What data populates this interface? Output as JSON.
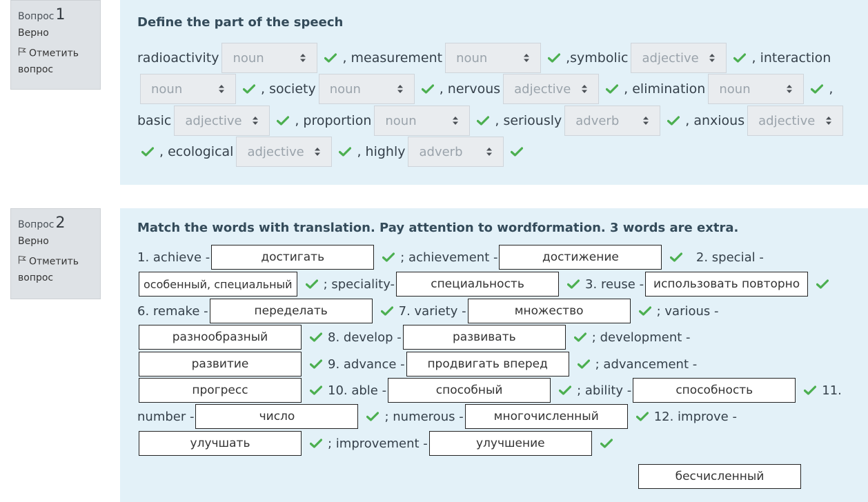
{
  "q1": {
    "label": "Вопрос",
    "number": "1",
    "state": "Верно",
    "flag": "Отметить вопрос",
    "question": "Define the part of the speech",
    "rows": [
      [
        {
          "t": "text",
          "v": "radioactivity"
        },
        {
          "t": "sel",
          "v": "noun"
        },
        {
          "t": "check"
        },
        {
          "t": "text",
          "v": ", measurement"
        },
        {
          "t": "sel",
          "v": "noun"
        },
        {
          "t": "check"
        },
        {
          "t": "text",
          "v": ",symbolic"
        },
        {
          "t": "sel",
          "v": "adjective"
        },
        {
          "t": "check"
        },
        {
          "t": "text",
          "v": ", interaction"
        }
      ],
      [
        {
          "t": "sel",
          "v": "noun"
        },
        {
          "t": "check"
        },
        {
          "t": "text",
          "v": ", society"
        },
        {
          "t": "sel",
          "v": "noun"
        },
        {
          "t": "check"
        },
        {
          "t": "text",
          "v": ", nervous"
        },
        {
          "t": "sel",
          "v": "adjective"
        },
        {
          "t": "check"
        },
        {
          "t": "text",
          "v": ", elimination"
        },
        {
          "t": "sel",
          "v": "noun"
        },
        {
          "t": "check"
        },
        {
          "t": "text",
          "v": ","
        }
      ],
      [
        {
          "t": "text",
          "v": "basic"
        },
        {
          "t": "sel",
          "v": "adjective"
        },
        {
          "t": "check"
        },
        {
          "t": "text",
          "v": ", proportion"
        },
        {
          "t": "sel",
          "v": "noun"
        },
        {
          "t": "check"
        },
        {
          "t": "text",
          "v": ", seriously"
        },
        {
          "t": "sel",
          "v": "adverb"
        },
        {
          "t": "check"
        },
        {
          "t": "text",
          "v": ", anxious"
        },
        {
          "t": "sel",
          "v": "adjective"
        }
      ],
      [
        {
          "t": "check"
        },
        {
          "t": "text",
          "v": ", ecological"
        },
        {
          "t": "sel",
          "v": "adjective"
        },
        {
          "t": "check"
        },
        {
          "t": "text",
          "v": ", highly"
        },
        {
          "t": "sel",
          "v": "adverb"
        },
        {
          "t": "check"
        }
      ]
    ]
  },
  "q2": {
    "label": "Вопрос",
    "number": "2",
    "state": "Верно",
    "flag": "Отметить вопрос",
    "question": "Match the words with translation. Pay attention to wordformation. 3 words are extra.",
    "rows": [
      [
        {
          "t": "text",
          "v": "1. achieve -"
        },
        {
          "t": "box",
          "v": "достигать"
        },
        {
          "t": "check"
        },
        {
          "t": "text",
          "v": "; achievement -"
        },
        {
          "t": "box",
          "v": "достижение"
        },
        {
          "t": "check"
        },
        {
          "t": "text",
          "v": "  2. special -"
        }
      ],
      [
        {
          "t": "box",
          "v": "особенный, специальный",
          "auto": true
        },
        {
          "t": "check"
        },
        {
          "t": "text",
          "v": "; speciality-"
        },
        {
          "t": "box",
          "v": "специальность"
        },
        {
          "t": "check"
        },
        {
          "t": "text",
          "v": "3. reuse -"
        },
        {
          "t": "box",
          "v": "использовать повторно"
        },
        {
          "t": "check"
        }
      ],
      [
        {
          "t": "text",
          "v": "6. remake -"
        },
        {
          "t": "box",
          "v": "переделать"
        },
        {
          "t": "check"
        },
        {
          "t": "text",
          "v": "7. variety -"
        },
        {
          "t": "box",
          "v": "множество"
        },
        {
          "t": "check"
        },
        {
          "t": "text",
          "v": "; various -"
        }
      ],
      [
        {
          "t": "box",
          "v": "разнообразный"
        },
        {
          "t": "check"
        },
        {
          "t": "text",
          "v": "8. develop -"
        },
        {
          "t": "box",
          "v": "развивать"
        },
        {
          "t": "check"
        },
        {
          "t": "text",
          "v": "; development -"
        }
      ],
      [
        {
          "t": "box",
          "v": "развитие"
        },
        {
          "t": "check"
        },
        {
          "t": "text",
          "v": "9. advance -"
        },
        {
          "t": "box",
          "v": "продвигать вперед"
        },
        {
          "t": "check"
        },
        {
          "t": "text",
          "v": "; advancement -"
        }
      ],
      [
        {
          "t": "box",
          "v": "прогресс"
        },
        {
          "t": "check"
        },
        {
          "t": "text",
          "v": "10. able -"
        },
        {
          "t": "box",
          "v": "способный"
        },
        {
          "t": "check"
        },
        {
          "t": "text",
          "v": "; ability -"
        },
        {
          "t": "box",
          "v": "способность"
        },
        {
          "t": "check"
        },
        {
          "t": "text",
          "v": "11."
        }
      ],
      [
        {
          "t": "text",
          "v": "number -"
        },
        {
          "t": "box",
          "v": "число"
        },
        {
          "t": "check"
        },
        {
          "t": "text",
          "v": "; numerous -"
        },
        {
          "t": "box",
          "v": "многочисленный"
        },
        {
          "t": "check"
        },
        {
          "t": "text",
          "v": "12. improve -"
        }
      ],
      [
        {
          "t": "box",
          "v": "улучшать"
        },
        {
          "t": "check"
        },
        {
          "t": "text",
          "v": "; improvement -"
        },
        {
          "t": "box",
          "v": "улучшение"
        },
        {
          "t": "check"
        }
      ]
    ],
    "extra": [
      "бесчисленный"
    ]
  }
}
